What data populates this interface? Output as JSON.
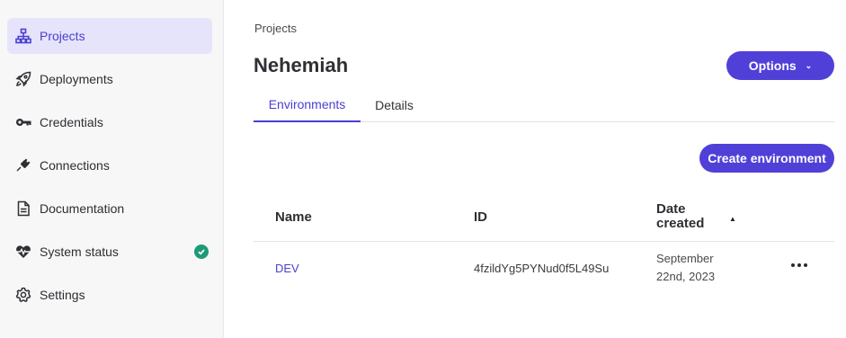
{
  "sidebar": {
    "items": [
      {
        "label": "Projects",
        "icon": "sitemap-icon",
        "active": true
      },
      {
        "label": "Deployments",
        "icon": "rocket-icon"
      },
      {
        "label": "Credentials",
        "icon": "key-icon"
      },
      {
        "label": "Connections",
        "icon": "plug-icon"
      },
      {
        "label": "Documentation",
        "icon": "document-icon"
      },
      {
        "label": "System status",
        "icon": "heartbeat-icon",
        "status": "ok"
      },
      {
        "label": "Settings",
        "icon": "gear-icon"
      }
    ]
  },
  "breadcrumb": "Projects",
  "page_title": "Nehemiah",
  "options_button": "Options",
  "tabs": [
    {
      "label": "Environments",
      "active": true
    },
    {
      "label": "Details",
      "active": false
    }
  ],
  "create_button": "Create environment",
  "table": {
    "columns": [
      "Name",
      "ID",
      "Date created"
    ],
    "date_header_lines": [
      "Date",
      "created"
    ],
    "sort": {
      "column": "Date created",
      "direction": "ascending"
    },
    "rows": [
      {
        "name": "DEV",
        "id": "4fzildYg5PYNud0f5L49Su",
        "date_lines": [
          "September",
          "22nd, 2023"
        ]
      }
    ]
  },
  "colors": {
    "accent": "#5040d8",
    "active_bg": "#e6e4fb",
    "status_ok": "#1e9a76"
  }
}
